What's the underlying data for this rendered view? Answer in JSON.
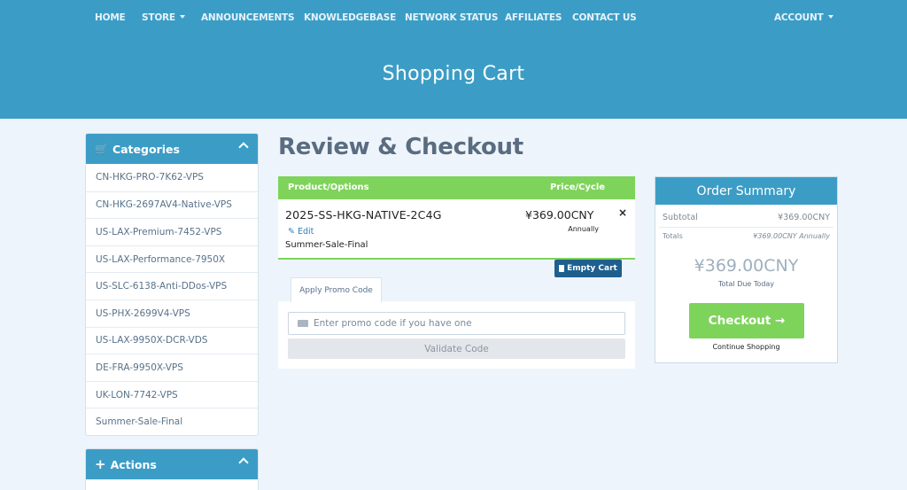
{
  "nav": {
    "home": "HOME",
    "store": "STORE",
    "announcements": "ANNOUNCEMENTS",
    "knowledgebase": "KNOWLEDGEBASE",
    "network_status": "NETWORK STATUS",
    "affiliates": "AFFILIATES",
    "contact_us": "CONTACT US",
    "account": "ACCOUNT"
  },
  "hero": {
    "title": "Shopping Cart"
  },
  "sidebar": {
    "categories_title": "Categories",
    "categories": [
      "CN-HKG-PRO-7K62-VPS",
      "CN-HKG-2697AV4-Native-VPS",
      "US-LAX-Premium-7452-VPS",
      "US-LAX-Performance-7950X",
      "US-SLC-6138-Anti-DDos-VPS",
      "US-PHX-2699V4-VPS",
      "US-LAX-9950X-DCR-VDS",
      "DE-FRA-9950X-VPS",
      "UK-LON-7742-VPS",
      "Summer-Sale-Final"
    ],
    "actions_title": "Actions"
  },
  "main": {
    "title": "Review & Checkout",
    "cart": {
      "col_product": "Product/Options",
      "col_price": "Price/Cycle",
      "item_name": "2025-SS-HKG-NATIVE-2C4G",
      "edit_label": "Edit",
      "item_group": "Summer-Sale-Final",
      "item_price": "¥369.00CNY",
      "item_cycle": "Annually",
      "remove": "×",
      "empty_label": "Empty Cart"
    },
    "promo": {
      "tab_label": "Apply Promo Code",
      "placeholder": "Enter promo code if you have one",
      "validate_label": "Validate Code"
    }
  },
  "summary": {
    "title": "Order Summary",
    "subtotal_label": "Subtotal",
    "subtotal_value": "¥369.00CNY",
    "totals_label": "Totals",
    "totals_value": "¥369.00CNY Annually",
    "total_due": "¥369.00CNY",
    "total_due_label": "Total Due Today",
    "checkout_label": "Checkout →",
    "continue_label": "Continue Shopping"
  },
  "colors": {
    "header": "#3b9dc6",
    "accent_green": "#7ed45a",
    "dark_button": "#1e5f8e",
    "page_bg": "#eef4fb"
  }
}
